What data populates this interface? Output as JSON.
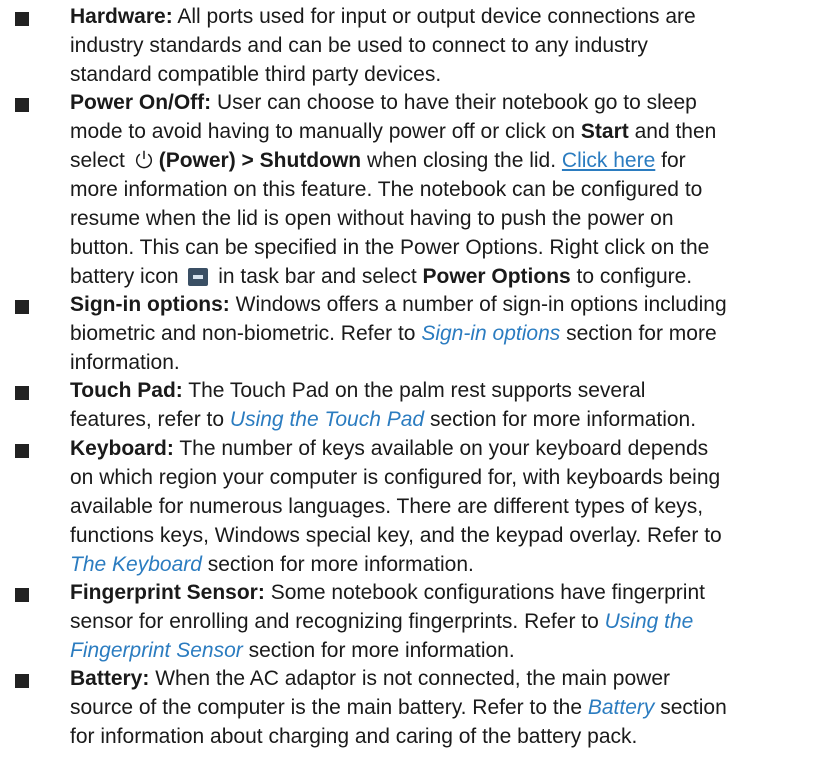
{
  "items": [
    {
      "id": "hardware",
      "title": "Hardware:",
      "text": " All ports used for input or output device connections are industry standards and can be used to connect to any industry standard compatible third party devices."
    },
    {
      "id": "power",
      "title": "Power On/Off:",
      "t1": " User can choose to have their notebook go to sleep mode to avoid having to manually power off or click on ",
      "start": "Start",
      "t2": " and then select ",
      "power_label": "(Power) > Shutdown",
      "t3": " when closing the lid. ",
      "link": "Click here",
      "t4": " for more information on this feature. The notebook can be configured to resume when the lid is open without having to push the power on button. This can be specified in the Power Options. Right click on the battery icon ",
      "t5": " in task bar and select ",
      "power_options": "Power Options",
      "t6": " to configure."
    },
    {
      "id": "signin",
      "title": "Sign-in options:",
      "t1": " Windows offers a number of sign-in options including biometric and non-biometric. Refer to ",
      "link": "Sign-in options",
      "t2": " section for more information."
    },
    {
      "id": "touchpad",
      "title": "Touch Pad:",
      "t1": " The Touch Pad on the palm rest supports several features, refer to ",
      "link": "Using the Touch Pad",
      "t2": " section for more information."
    },
    {
      "id": "keyboard",
      "title": "Keyboard:",
      "t1": " The number of keys available on your keyboard depends on which region your computer is configured for, with keyboards being available for numerous languages. There are different types of keys, functions keys, Windows special key, and the keypad overlay. Refer to ",
      "link": "The Keyboard",
      "t2": " section for more information."
    },
    {
      "id": "fingerprint",
      "title": "Fingerprint Sensor:",
      "t1": " Some notebook configurations have fingerprint sensor for enrolling and recognizing fingerprints. Refer to ",
      "link": "Using the Fingerprint Sensor",
      "t2": " section for more information."
    },
    {
      "id": "battery",
      "title": "Battery:",
      "t1": " When the AC adaptor is not connected, the main power source of the computer is the main battery. Refer to the ",
      "link": "Battery",
      "t2": " section for information about charging and caring of the battery pack."
    }
  ],
  "icons": {
    "bullet": "square-bullet-icon",
    "power": "power-icon",
    "battery": "battery-icon"
  },
  "colors": {
    "text": "#1a1a1a",
    "link": "#2b7cc0",
    "bullet": "#222222"
  }
}
